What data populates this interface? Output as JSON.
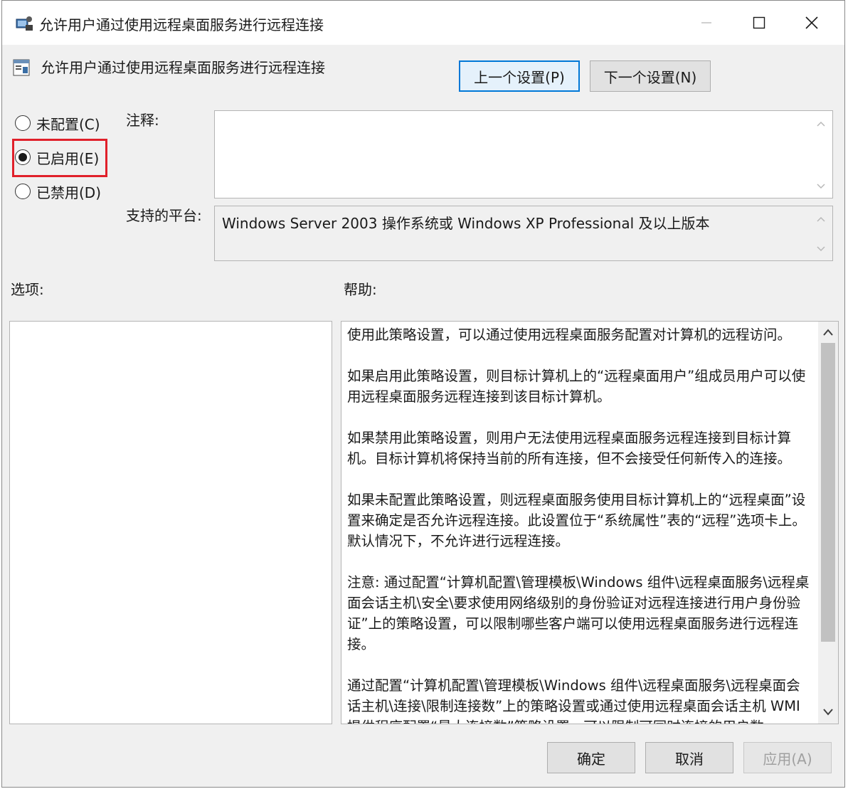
{
  "window": {
    "title": "允许用户通过使用远程桌面服务进行远程连接",
    "controls": {
      "minimize": "minimize",
      "maximize": "maximize",
      "close": "close"
    }
  },
  "header": {
    "policy_title": "允许用户通过使用远程桌面服务进行远程连接",
    "prev_button": "上一个设置(P)",
    "next_button": "下一个设置(N)"
  },
  "state": {
    "options": [
      {
        "label": "未配置(C)",
        "selected": false
      },
      {
        "label": "已启用(E)",
        "selected": true
      },
      {
        "label": "已禁用(D)",
        "selected": false
      }
    ],
    "highlight_color": "#e0202a"
  },
  "comment": {
    "label": "注释:",
    "value": ""
  },
  "platform": {
    "label": "支持的平台:",
    "value": "Windows Server 2003 操作系统或 Windows XP Professional 及以上版本"
  },
  "options_panel": {
    "label": "选项:"
  },
  "help_panel": {
    "label": "帮助:",
    "paragraphs": [
      "使用此策略设置，可以通过使用远程桌面服务配置对计算机的远程访问。",
      "如果启用此策略设置，则目标计算机上的“远程桌面用户”组成员用户可以使用远程桌面服务远程连接到该目标计算机。",
      "如果禁用此策略设置，则用户无法使用远程桌面服务远程连接到目标计算机。目标计算机将保持当前的所有连接，但不会接受任何新传入的连接。",
      "如果未配置此策略设置，则远程桌面服务使用目标计算机上的“远程桌面”设置来确定是否允许远程连接。此设置位于“系统属性”表的“远程”选项卡上。默认情况下，不允许进行远程连接。",
      "注意: 通过配置“计算机配置\\管理模板\\Windows 组件\\远程桌面服务\\远程桌面会话主机\\安全\\要求使用网络级别的身份验证对远程连接进行用户身份验证”上的策略设置，可以限制哪些客户端可以使用远程桌面服务进行远程连接。",
      "通过配置“计算机配置\\管理模板\\Windows 组件\\远程桌面服务\\远程桌面会话主机\\连接\\限制连接数”上的策略设置或通过使用远程桌面会话主机 WMI 提供程序配置“最大连接数”策略设置，可以限制可同时连接的用户数。"
    ]
  },
  "footer": {
    "ok": "确定",
    "cancel": "取消",
    "apply": "应用(A)"
  }
}
